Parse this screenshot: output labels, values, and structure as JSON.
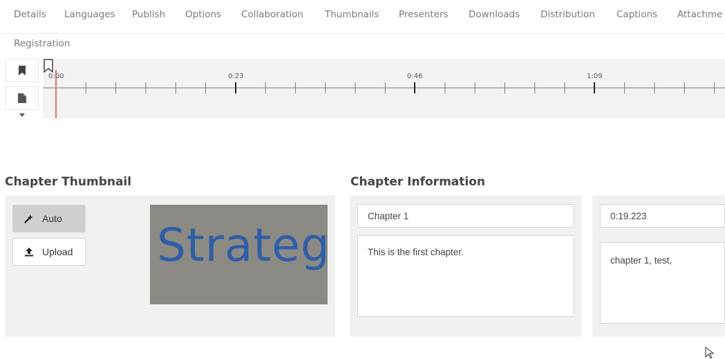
{
  "tabs": [
    "Details",
    "Languages",
    "Publish",
    "Options",
    "Collaboration",
    "Thumbnails",
    "Presenters",
    "Downloads",
    "Distribution",
    "Captions",
    "Attachme"
  ],
  "tabs_row2": [
    "Registration"
  ],
  "timeline": {
    "ticks": [
      "0:00",
      "0:23",
      "0:46",
      "1:09"
    ],
    "playhead_color": "#e0463a",
    "icons": [
      "bookmark-icon",
      "file-icon",
      "caret-down-icon"
    ]
  },
  "thumbnail_section": {
    "title": "Chapter Thumbnail",
    "auto_label": "Auto",
    "upload_label": "Upload",
    "image_text": "Strategy"
  },
  "info_section": {
    "title": "Chapter Information",
    "chapter_title": "Chapter 1",
    "description": "This is the first chapter.",
    "timestamp": "0:19.223",
    "keywords": "chapter 1, test,"
  }
}
